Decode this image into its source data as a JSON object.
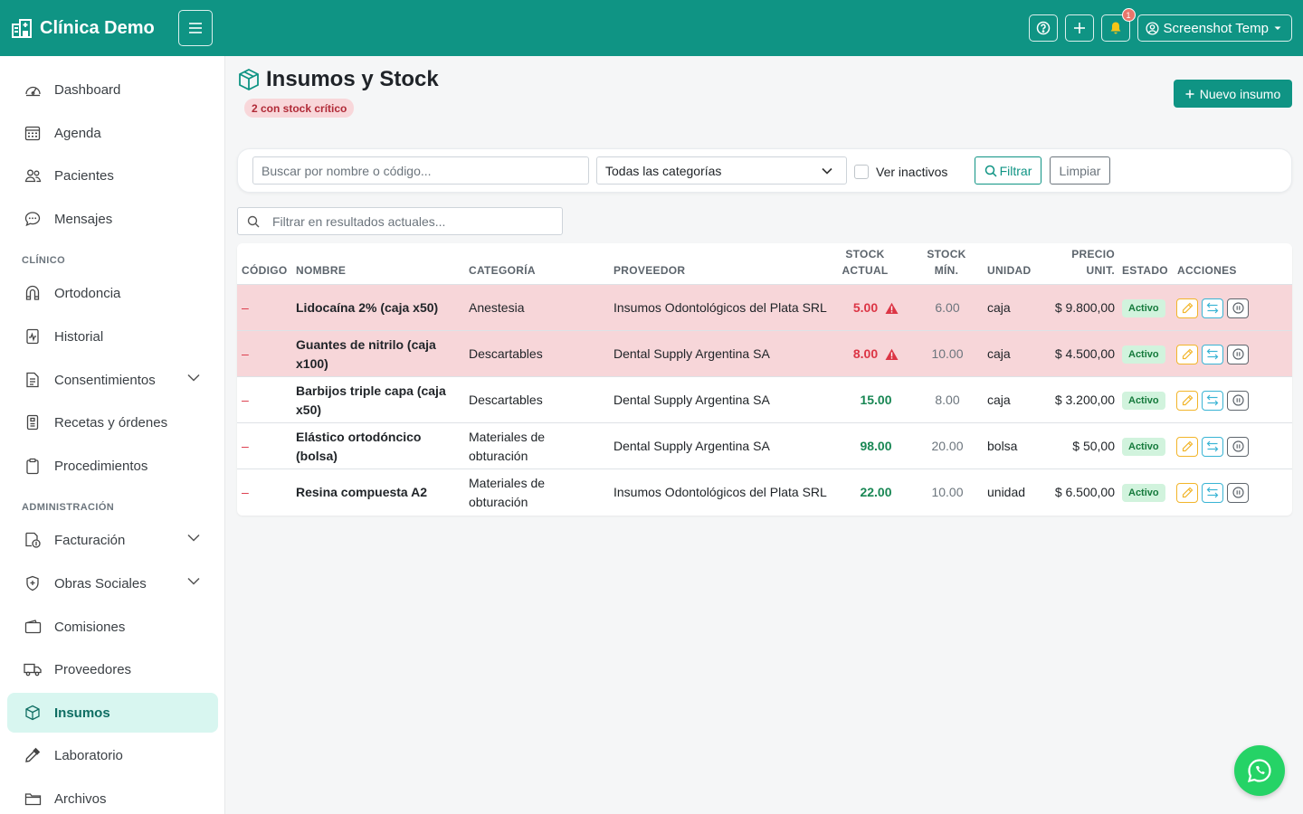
{
  "brand": {
    "name": "Clínica Demo"
  },
  "topbar": {
    "user_label": "Screenshot Temp",
    "notification_count": "1"
  },
  "sidebar": {
    "items": [
      {
        "label": "Dashboard",
        "icon": "speedometer-icon"
      },
      {
        "label": "Agenda",
        "icon": "calendar-icon"
      },
      {
        "label": "Pacientes",
        "icon": "people-icon"
      },
      {
        "label": "Mensajes",
        "icon": "chat-icon"
      },
      {
        "label": "Ortodoncia",
        "icon": "magnet-icon"
      },
      {
        "label": "Historial",
        "icon": "file-medical-icon"
      },
      {
        "label": "Consentimientos",
        "icon": "file-text-icon"
      },
      {
        "label": "Recetas y órdenes",
        "icon": "file-list-icon"
      },
      {
        "label": "Procedimientos",
        "icon": "clipboard-icon"
      },
      {
        "label": "Facturación",
        "icon": "cash-icon"
      },
      {
        "label": "Obras Sociales",
        "icon": "shield-icon"
      },
      {
        "label": "Comisiones",
        "icon": "wallet-icon"
      },
      {
        "label": "Proveedores",
        "icon": "truck-icon"
      },
      {
        "label": "Insumos",
        "icon": "box-icon"
      },
      {
        "label": "Laboratorio",
        "icon": "eyedropper-icon"
      },
      {
        "label": "Archivos",
        "icon": "folder-icon"
      }
    ],
    "sections": {
      "clinico": "CLÍNICO",
      "administracion": "ADMINISTRACIÓN"
    }
  },
  "page": {
    "title": "Insumos y Stock",
    "critical_badge": "2 con stock crítico",
    "new_button": "Nuevo insumo"
  },
  "filters": {
    "search_placeholder": "Buscar por nombre o código...",
    "category_selected": "Todas las categorías",
    "inactive_label": "Ver inactivos",
    "filter_button": "Filtrar",
    "clear_button": "Limpiar",
    "results_placeholder": "Filtrar en resultados actuales..."
  },
  "table": {
    "headers": {
      "codigo": "CÓDIGO",
      "nombre": "NOMBRE",
      "categoria": "CATEGORÍA",
      "proveedor": "PROVEEDOR",
      "stock_actual_1": "STOCK",
      "stock_actual_2": "ACTUAL",
      "stock_min_1": "STOCK",
      "stock_min_2": "MÍN.",
      "unidad": "UNIDAD",
      "precio_1": "PRECIO",
      "precio_2": "UNIT.",
      "estado": "ESTADO",
      "acciones": "ACCIONES"
    },
    "rows": [
      {
        "codigo": "–",
        "nombre": "Lidocaína 2% (caja x50)",
        "categoria": "Anestesia",
        "proveedor": "Insumos Odontológicos del Plata SRL",
        "stock": "5.00",
        "min": "6.00",
        "unidad": "caja",
        "precio": "$ 9.800,00",
        "estado": "Activo"
      },
      {
        "codigo": "–",
        "nombre": "Guantes de nitrilo (caja x100)",
        "categoria": "Descartables",
        "proveedor": "Dental Supply Argentina SA",
        "stock": "8.00",
        "min": "10.00",
        "unidad": "caja",
        "precio": "$ 4.500,00",
        "estado": "Activo"
      },
      {
        "codigo": "–",
        "nombre": "Barbijos triple capa (caja x50)",
        "categoria": "Descartables",
        "proveedor": "Dental Supply Argentina SA",
        "stock": "15.00",
        "min": "8.00",
        "unidad": "caja",
        "precio": "$ 3.200,00",
        "estado": "Activo"
      },
      {
        "codigo": "–",
        "nombre": "Elástico ortodóncico (bolsa)",
        "categoria": "Materiales de obturación",
        "proveedor": "Dental Supply Argentina SA",
        "stock": "98.00",
        "min": "20.00",
        "unidad": "bolsa",
        "precio": "$ 50,00",
        "estado": "Activo"
      },
      {
        "codigo": "–",
        "nombre": "Resina compuesta A2",
        "categoria": "Materiales de obturación",
        "proveedor": "Insumos Odontológicos del Plata SRL",
        "stock": "22.00",
        "min": "10.00",
        "unidad": "unidad",
        "precio": "$ 6.500,00",
        "estado": "Activo"
      }
    ]
  },
  "colors": {
    "primary": "#0f9484",
    "critical_row": "#f7d6d9",
    "active_nav": "#d8f6f0"
  }
}
